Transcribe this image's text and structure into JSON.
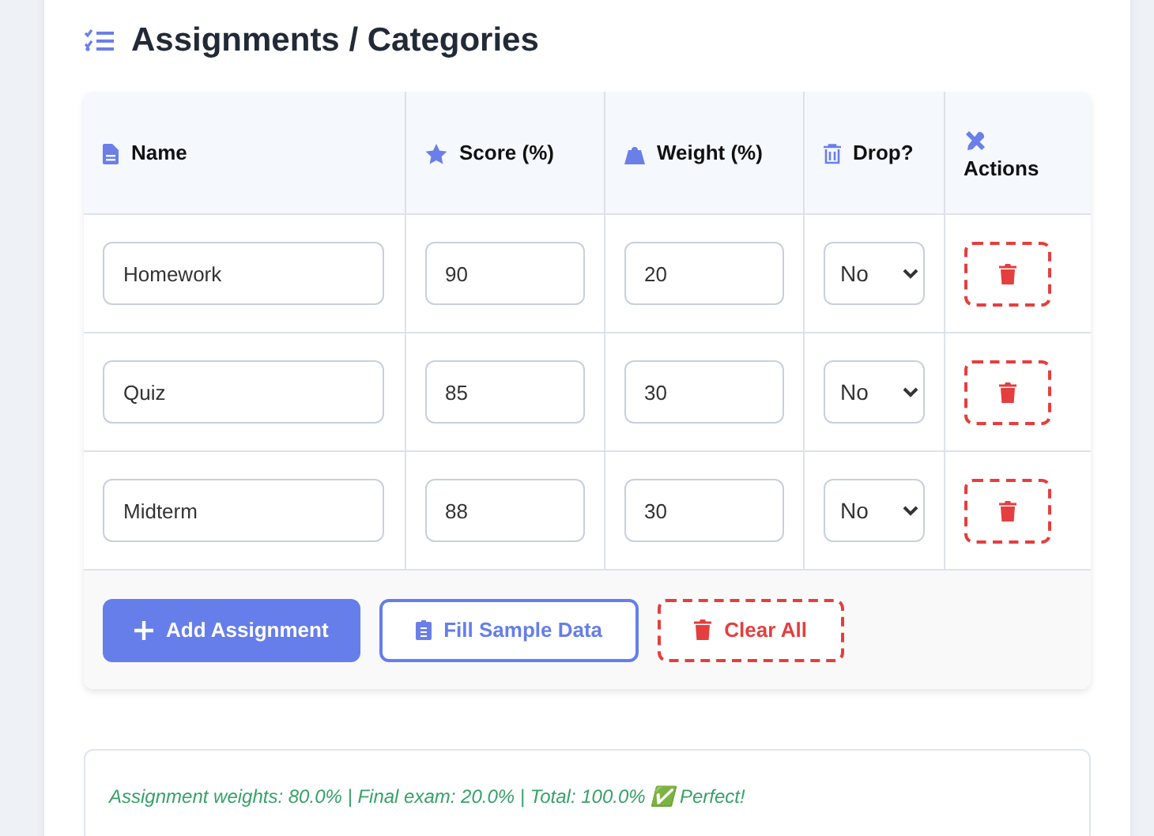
{
  "section": {
    "title": "Assignments / Categories"
  },
  "table": {
    "columns": [
      {
        "label": "Name",
        "kind": "file"
      },
      {
        "label": "Score (%)",
        "kind": "star"
      },
      {
        "label": "Weight (%)",
        "kind": "weight"
      },
      {
        "label": "Drop?",
        "kind": "trash"
      },
      {
        "label": "Actions",
        "kind": "tools"
      }
    ],
    "rows": [
      {
        "name": "Homework",
        "score": "90",
        "weight": "20",
        "drop": "No"
      },
      {
        "name": "Quiz",
        "score": "85",
        "weight": "30",
        "drop": "No"
      },
      {
        "name": "Midterm",
        "score": "88",
        "weight": "30",
        "drop": "No"
      }
    ]
  },
  "buttons": [
    {
      "label": "Add Assignment",
      "kind": "primary"
    },
    {
      "label": "Fill Sample Data",
      "kind": "outline"
    },
    {
      "label": "Clear All",
      "kind": "danger"
    }
  ],
  "summary": "Assignment weights: 80.0% | Final exam: 20.0% | Total: 100.0% ✅ Perfect!"
}
